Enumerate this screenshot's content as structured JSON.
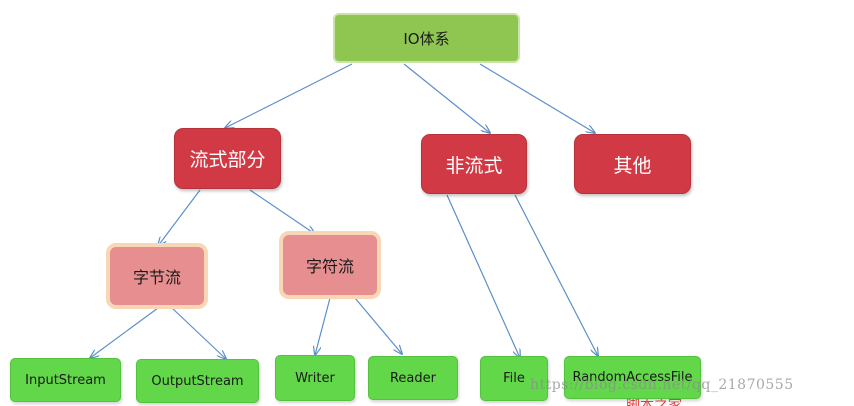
{
  "nodes": {
    "root": "IO体系",
    "stream_part": "流式部分",
    "non_stream": "非流式",
    "other": "其他",
    "byte_stream": "字节流",
    "char_stream": "字符流",
    "input_stream": "InputStream",
    "output_stream": "OutputStream",
    "writer": "Writer",
    "reader": "Reader",
    "file": "File",
    "random_access_file": "RandomAccessFile"
  },
  "watermark": "https://blog.csdn.net/qq_21870555",
  "colors": {
    "root_green": "#8fc652",
    "category_red": "#d13a44",
    "sub_pink": "#e78e90",
    "leaf_green": "#62d74a",
    "arrow_blue": "#5b8fc9"
  }
}
